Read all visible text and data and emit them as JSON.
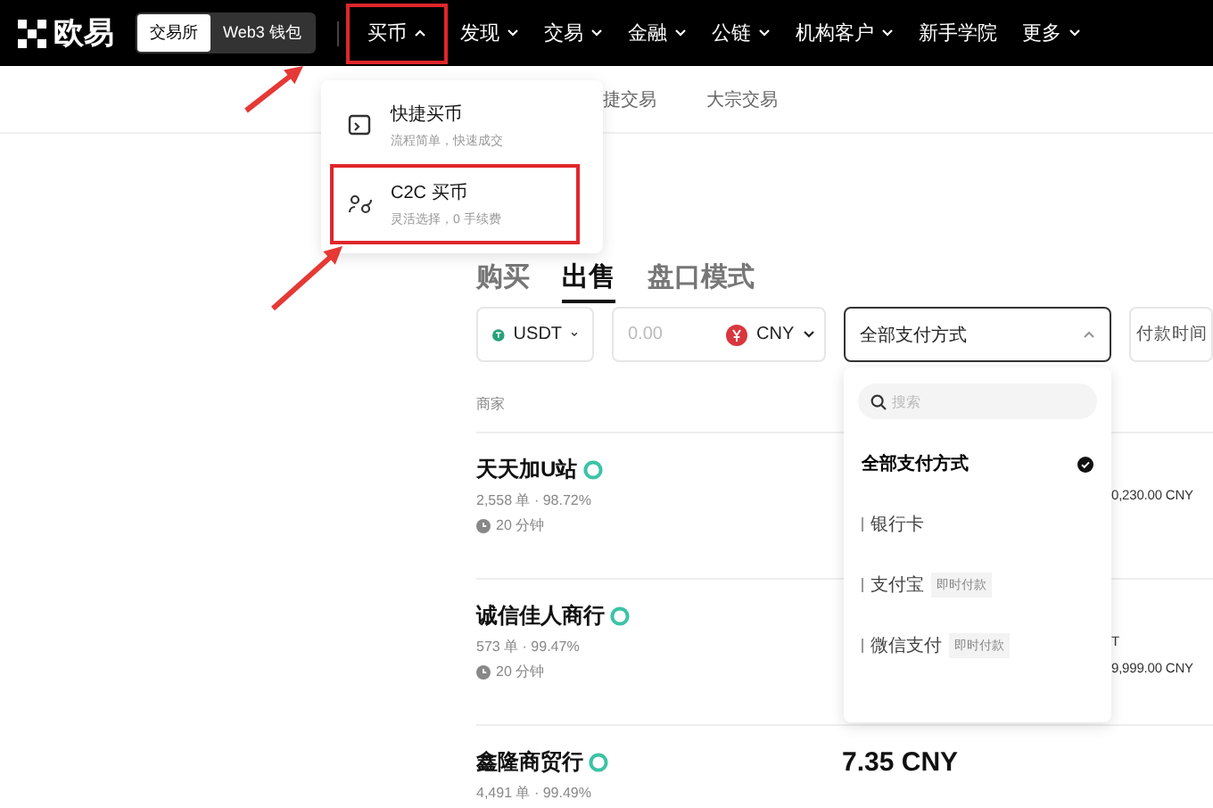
{
  "nav": {
    "logo": "欧易",
    "mode_toggle": [
      {
        "label": "交易所",
        "selected": true
      },
      {
        "label": "Web3 钱包",
        "selected": false
      }
    ],
    "items": [
      {
        "label": "买币",
        "has_menu": true,
        "expanded": true,
        "highlighted": true
      },
      {
        "label": "发现",
        "has_menu": true,
        "expanded": false,
        "highlighted": false
      },
      {
        "label": "交易",
        "has_menu": true,
        "expanded": false,
        "highlighted": false
      },
      {
        "label": "金融",
        "has_menu": true,
        "expanded": false,
        "highlighted": false
      },
      {
        "label": "公链",
        "has_menu": true,
        "expanded": false,
        "highlighted": false
      },
      {
        "label": "机构客户",
        "has_menu": true,
        "expanded": false,
        "highlighted": false
      },
      {
        "label": "新手学院",
        "has_menu": false,
        "expanded": false,
        "highlighted": false
      },
      {
        "label": "更多",
        "has_menu": true,
        "expanded": false,
        "highlighted": false
      }
    ]
  },
  "buy_menu": {
    "items": [
      {
        "kind": "quick",
        "title": "快捷买币",
        "subtitle": "流程简单，快速成交",
        "highlighted": false
      },
      {
        "kind": "c2c",
        "title": "C2C 买币",
        "subtitle": "灵活选择，0 手续费",
        "highlighted": true
      }
    ]
  },
  "sub_nav": [
    "捷交易",
    "大宗交易"
  ],
  "trade_tabs": [
    {
      "label": "购买",
      "selected": false
    },
    {
      "label": "出售",
      "selected": true
    },
    {
      "label": "盘口模式",
      "selected": false
    }
  ],
  "filters": {
    "crypto": "USDT",
    "amount_placeholder": "0.00",
    "fiat": "CNY",
    "payment": "全部支付方式",
    "payment_expanded": true,
    "sort": "付款时间"
  },
  "table": {
    "column_1": "商家",
    "rows": [
      {
        "merchant": "天天加U站",
        "orders": "2,558 单 · 98.72%",
        "time": "20 分钟",
        "price": "",
        "limit_1": "",
        "limit_2": "0,230.00 CNY"
      },
      {
        "merchant": "诚信佳人商行",
        "orders": "573 单 · 99.47%",
        "time": "20 分钟",
        "price": "",
        "limit_1": "T",
        "limit_2": "9,999.00 CNY"
      },
      {
        "merchant": "鑫隆商贸行",
        "orders": "4,491 单 · 99.49%",
        "time": "",
        "price": "7.35 CNY",
        "limit_1": "",
        "limit_2": ""
      }
    ]
  },
  "payment_dropdown": {
    "search_placeholder": "搜索",
    "options": [
      {
        "label": "全部支付方式",
        "selected": true,
        "kind": "all"
      },
      {
        "label": "银行卡",
        "selected": false,
        "kind": "method"
      },
      {
        "label": "支付宝",
        "tag": "即时付款",
        "selected": false,
        "kind": "method"
      },
      {
        "label": "微信支付",
        "tag": "即时付款",
        "selected": false,
        "kind": "method"
      }
    ]
  }
}
